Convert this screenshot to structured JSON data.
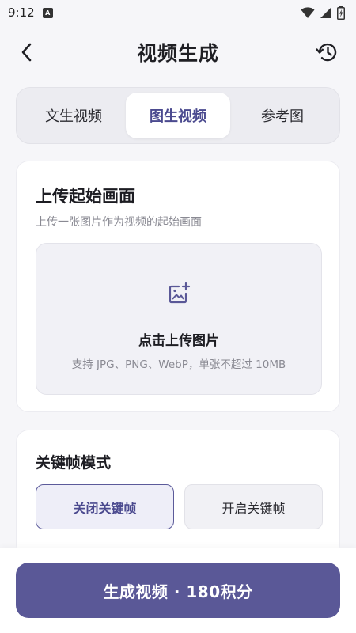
{
  "status_bar": {
    "time": "9:12",
    "notification_badge": "A",
    "icons": [
      "wifi-icon",
      "signal-icon",
      "battery-icon"
    ]
  },
  "header": {
    "title": "视频生成",
    "back_icon": "chevron-left-icon",
    "history_icon": "history-icon"
  },
  "tabs": [
    {
      "label": "文生视频",
      "active": false
    },
    {
      "label": "图生视频",
      "active": true
    },
    {
      "label": "参考图",
      "active": false
    }
  ],
  "upload": {
    "title": "上传起始画面",
    "subtitle": "上传一张图片作为视频的起始画面",
    "dropzone_icon": "add-image-icon",
    "dropzone_title": "点击上传图片",
    "dropzone_hint": "支持 JPG、PNG、WebP，单张不超过 10MB"
  },
  "keyframe": {
    "title": "关键帧模式",
    "options": [
      {
        "label": "关闭关键帧",
        "selected": true
      },
      {
        "label": "开启关键帧",
        "selected": false
      }
    ]
  },
  "generate_button": {
    "label": "生成视频 · 180积分"
  },
  "colors": {
    "accent": "#5a5897",
    "accent_text": "#4b4a8f",
    "background": "#f6f6f9",
    "card": "#ffffff"
  }
}
